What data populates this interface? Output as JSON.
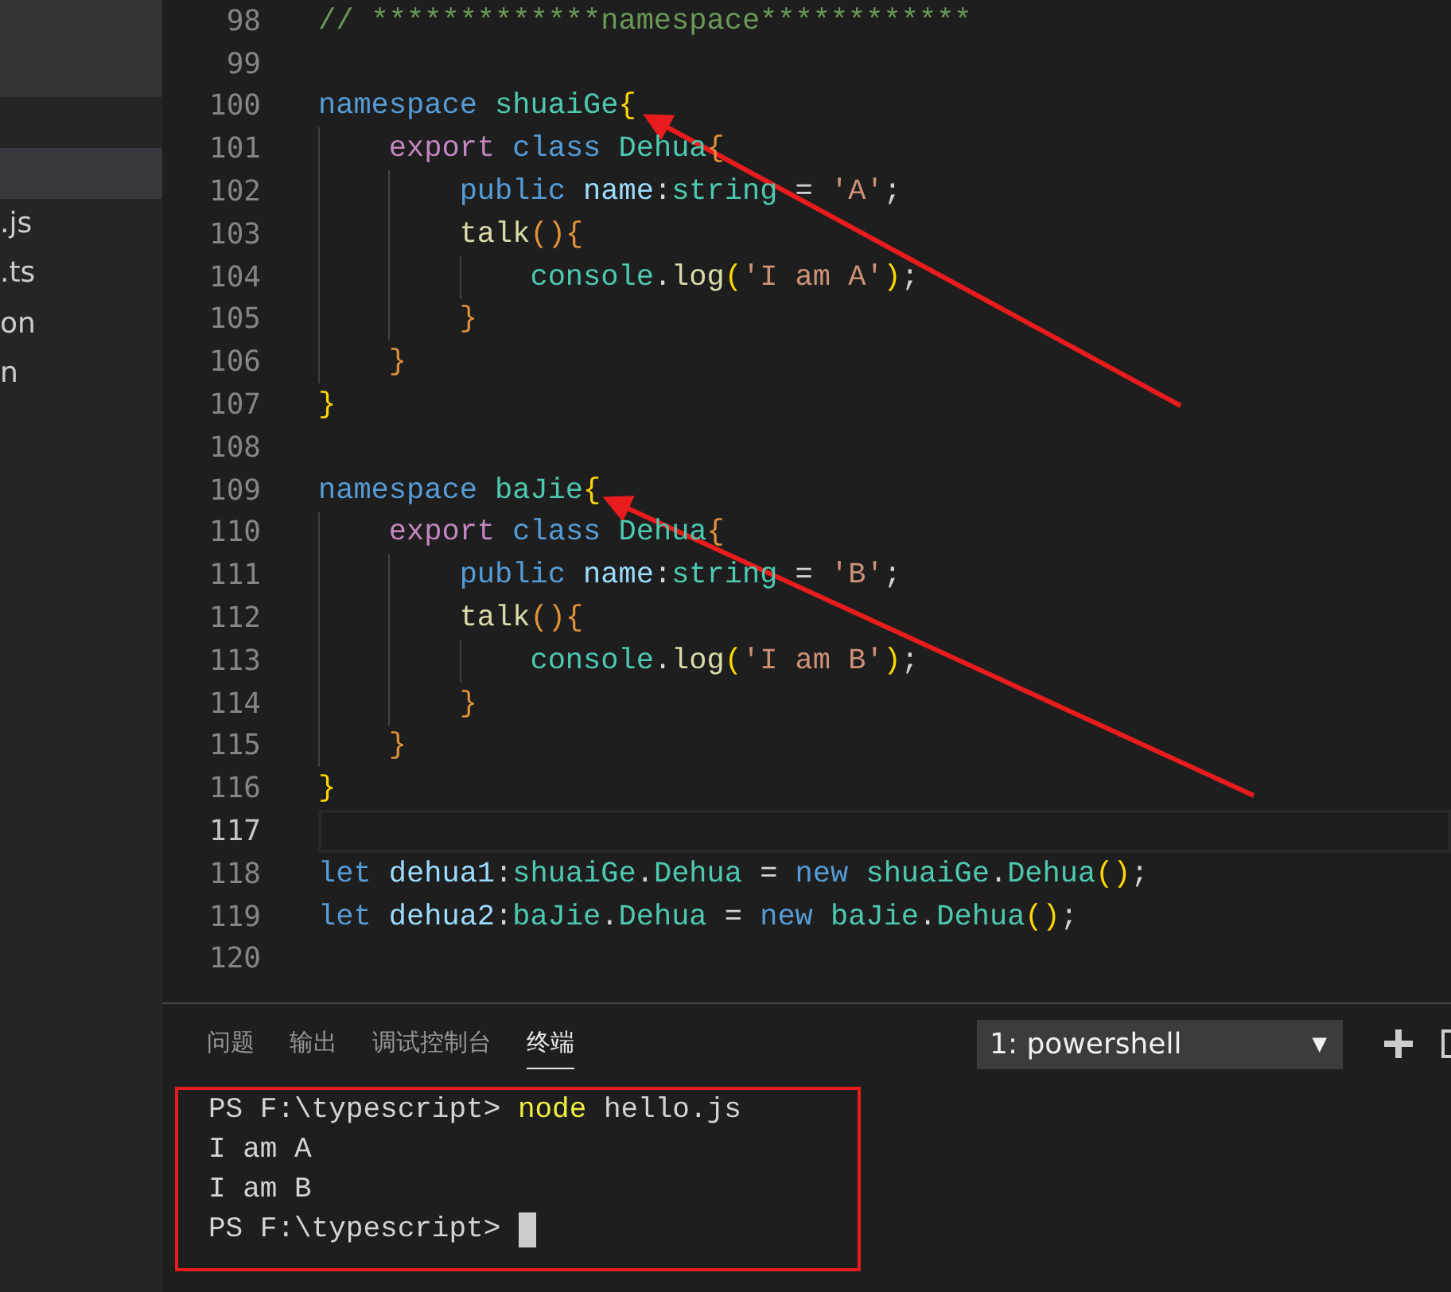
{
  "sidebar": {
    "items": [
      {
        "selected": true
      },
      {
        "label": ".js",
        "selected": false
      },
      {
        "label": ".ts",
        "selected": false
      },
      {
        "label": "on",
        "selected": false
      },
      {
        "label": "n",
        "selected": false
      }
    ]
  },
  "editor": {
    "lines": [
      {
        "number": "98",
        "current": false,
        "tokens": [
          {
            "text": "// *************namespace************",
            "kind": "comment"
          }
        ]
      },
      {
        "number": "99",
        "current": false
      },
      {
        "number": "100",
        "current": false,
        "tokens": [
          {
            "text": "namespace",
            "kind": "keyword"
          },
          {
            "text": " shuaiGe",
            "kind": "type"
          },
          {
            "text": "{",
            "kind": "bracket1"
          }
        ]
      },
      {
        "number": "101",
        "current": false,
        "tokens": [
          {
            "text": "    export",
            "kind": "control"
          },
          {
            "text": " class",
            "kind": "keyword"
          },
          {
            "text": " Dehua",
            "kind": "type"
          },
          {
            "text": "{",
            "kind": "bracket2"
          }
        ]
      },
      {
        "number": "102",
        "current": false,
        "tokens": [
          {
            "text": "        public",
            "kind": "keyword"
          },
          {
            "text": " name",
            "kind": "variable"
          },
          {
            "text": ":",
            "kind": "plain"
          },
          {
            "text": "string",
            "kind": "type"
          },
          {
            "text": " =",
            "kind": "plain"
          },
          {
            "text": " 'A'",
            "kind": "string"
          },
          {
            "text": ";",
            "kind": "plain"
          }
        ]
      },
      {
        "number": "103",
        "current": false,
        "tokens": [
          {
            "text": "        talk",
            "kind": "function"
          },
          {
            "text": "(){",
            "kind": "bracket2"
          }
        ]
      },
      {
        "number": "104",
        "current": false,
        "tokens": [
          {
            "text": "            console",
            "kind": "type"
          },
          {
            "text": ".",
            "kind": "plain"
          },
          {
            "text": "log",
            "kind": "function"
          },
          {
            "text": "(",
            "kind": "bracket1"
          },
          {
            "text": "'I am A'",
            "kind": "string"
          },
          {
            "text": ")",
            "kind": "bracket1"
          },
          {
            "text": ";",
            "kind": "plain"
          }
        ]
      },
      {
        "number": "105",
        "current": false,
        "tokens": [
          {
            "text": "        }",
            "kind": "bracket2"
          }
        ]
      },
      {
        "number": "106",
        "current": false,
        "tokens": [
          {
            "text": "    }",
            "kind": "bracket2"
          }
        ]
      },
      {
        "number": "107",
        "current": false,
        "tokens": [
          {
            "text": "}",
            "kind": "bracket1"
          }
        ]
      },
      {
        "number": "108",
        "current": false
      },
      {
        "number": "109",
        "current": false,
        "tokens": [
          {
            "text": "namespace",
            "kind": "keyword"
          },
          {
            "text": " baJie",
            "kind": "type"
          },
          {
            "text": "{",
            "kind": "bracket1"
          }
        ]
      },
      {
        "number": "110",
        "current": false,
        "tokens": [
          {
            "text": "    export",
            "kind": "control"
          },
          {
            "text": " class",
            "kind": "keyword"
          },
          {
            "text": " Dehua",
            "kind": "type"
          },
          {
            "text": "{",
            "kind": "bracket2"
          }
        ]
      },
      {
        "number": "111",
        "current": false,
        "tokens": [
          {
            "text": "        public",
            "kind": "keyword"
          },
          {
            "text": " name",
            "kind": "variable"
          },
          {
            "text": ":",
            "kind": "plain"
          },
          {
            "text": "string",
            "kind": "type"
          },
          {
            "text": " =",
            "kind": "plain"
          },
          {
            "text": " 'B'",
            "kind": "string"
          },
          {
            "text": ";",
            "kind": "plain"
          }
        ]
      },
      {
        "number": "112",
        "current": false,
        "tokens": [
          {
            "text": "        talk",
            "kind": "function"
          },
          {
            "text": "(){",
            "kind": "bracket2"
          }
        ]
      },
      {
        "number": "113",
        "current": false,
        "tokens": [
          {
            "text": "            console",
            "kind": "type"
          },
          {
            "text": ".",
            "kind": "plain"
          },
          {
            "text": "log",
            "kind": "function"
          },
          {
            "text": "(",
            "kind": "bracket1"
          },
          {
            "text": "'I am B'",
            "kind": "string"
          },
          {
            "text": ")",
            "kind": "bracket1"
          },
          {
            "text": ";",
            "kind": "plain"
          }
        ]
      },
      {
        "number": "114",
        "current": false,
        "tokens": [
          {
            "text": "        }",
            "kind": "bracket2"
          }
        ]
      },
      {
        "number": "115",
        "current": false,
        "tokens": [
          {
            "text": "    }",
            "kind": "bracket2"
          }
        ]
      },
      {
        "number": "116",
        "current": false,
        "tokens": [
          {
            "text": "}",
            "kind": "bracket1"
          }
        ]
      },
      {
        "number": "117",
        "current": true
      },
      {
        "number": "118",
        "current": false,
        "tokens": [
          {
            "text": "let",
            "kind": "keyword"
          },
          {
            "text": " dehua1",
            "kind": "variable"
          },
          {
            "text": ":",
            "kind": "plain"
          },
          {
            "text": "shuaiGe",
            "kind": "type"
          },
          {
            "text": ".",
            "kind": "plain"
          },
          {
            "text": "Dehua",
            "kind": "type"
          },
          {
            "text": " =",
            "kind": "plain"
          },
          {
            "text": " new",
            "kind": "keyword"
          },
          {
            "text": " shuaiGe",
            "kind": "type"
          },
          {
            "text": ".",
            "kind": "plain"
          },
          {
            "text": "Dehua",
            "kind": "type"
          },
          {
            "text": "()",
            "kind": "bracket1"
          },
          {
            "text": ";",
            "kind": "plain"
          }
        ]
      },
      {
        "number": "119",
        "current": false,
        "tokens": [
          {
            "text": "let",
            "kind": "keyword"
          },
          {
            "text": " dehua2",
            "kind": "variable"
          },
          {
            "text": ":",
            "kind": "plain"
          },
          {
            "text": "baJie",
            "kind": "type"
          },
          {
            "text": ".",
            "kind": "plain"
          },
          {
            "text": "Dehua",
            "kind": "type"
          },
          {
            "text": " =",
            "kind": "plain"
          },
          {
            "text": " new",
            "kind": "keyword"
          },
          {
            "text": " baJie",
            "kind": "type"
          },
          {
            "text": ".",
            "kind": "plain"
          },
          {
            "text": "Dehua",
            "kind": "type"
          },
          {
            "text": "()",
            "kind": "bracket1"
          },
          {
            "text": ";",
            "kind": "plain"
          }
        ]
      },
      {
        "number": "120",
        "current": false
      }
    ]
  },
  "panel": {
    "tabs": [
      {
        "label": "问题",
        "selected": false
      },
      {
        "label": "输出",
        "selected": false
      },
      {
        "label": "调试控制台",
        "selected": false
      },
      {
        "label": "终端",
        "selected": true
      }
    ],
    "terminal_select": {
      "value": "1: powershell",
      "caret": "▼"
    },
    "terminal": {
      "lines": [
        {
          "cursor": false,
          "tokens": [
            {
              "text": "PS F:\\typescript>",
              "kind": "plain"
            },
            {
              "text": " node",
              "kind": "command"
            },
            {
              "text": " hello.js",
              "kind": "plain"
            }
          ]
        },
        {
          "cursor": false,
          "tokens": [
            {
              "text": "I am A",
              "kind": "plain"
            }
          ]
        },
        {
          "cursor": false,
          "tokens": [
            {
              "text": "I am B",
              "kind": "plain"
            }
          ]
        },
        {
          "cursor": true,
          "tokens": [
            {
              "text": "PS F:\\typescript>",
              "kind": "plain"
            }
          ]
        }
      ]
    }
  }
}
